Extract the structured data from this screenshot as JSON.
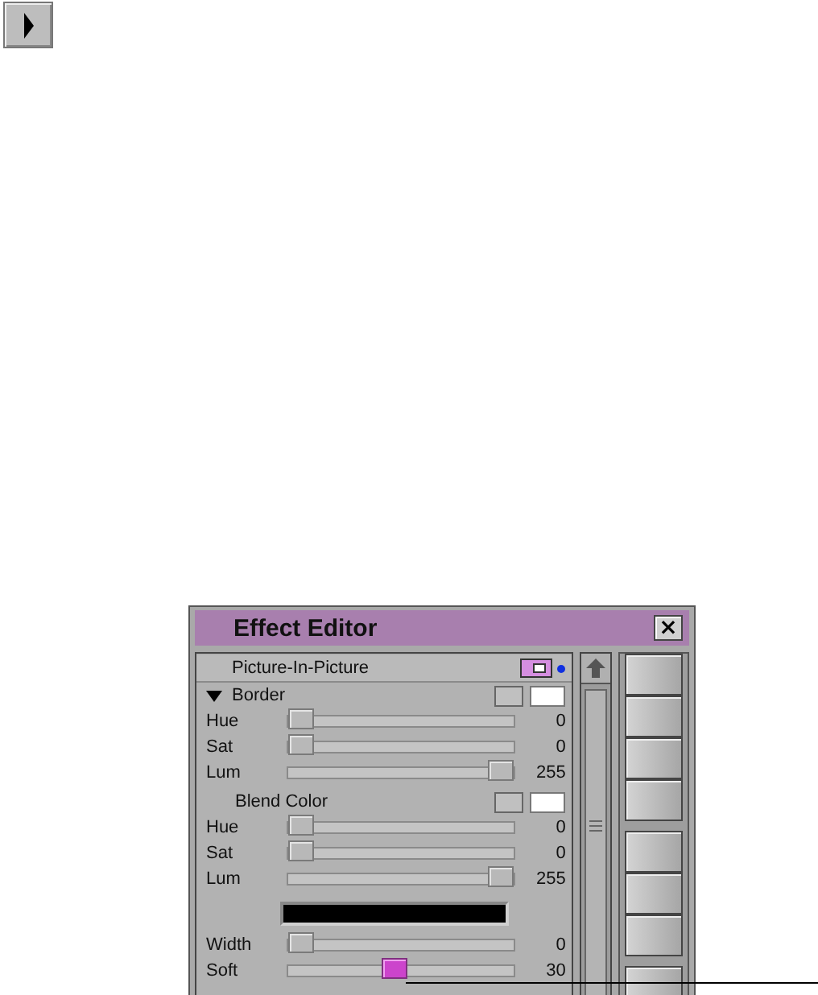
{
  "window": {
    "title": "Effect Editor",
    "close": "×"
  },
  "rows": [
    {
      "kind": "header",
      "label": "Picture-In-Picture"
    },
    {
      "kind": "section",
      "label": "Border",
      "expanded": true
    },
    {
      "kind": "slider",
      "label": "Hue",
      "level": 0,
      "reading": "0"
    },
    {
      "kind": "slider",
      "label": "Sat",
      "level": 0,
      "reading": "0"
    },
    {
      "kind": "slider",
      "label": "Lum",
      "level": 1,
      "reading": "255"
    },
    {
      "kind": "subsection",
      "label": "Blend Color"
    },
    {
      "kind": "slider",
      "label": "Hue",
      "level": 0,
      "reading": "0"
    },
    {
      "kind": "slider",
      "label": "Sat",
      "level": 0,
      "reading": "0"
    },
    {
      "kind": "slider",
      "label": "Lum",
      "level": 1,
      "reading": "255"
    },
    {
      "kind": "colorbar",
      "color": "#000000"
    },
    {
      "kind": "slider",
      "label": "Width",
      "level": 0,
      "reading": "0"
    },
    {
      "kind": "slider",
      "label": "Soft",
      "level": 0.47,
      "reading": "30",
      "selected": true
    }
  ]
}
